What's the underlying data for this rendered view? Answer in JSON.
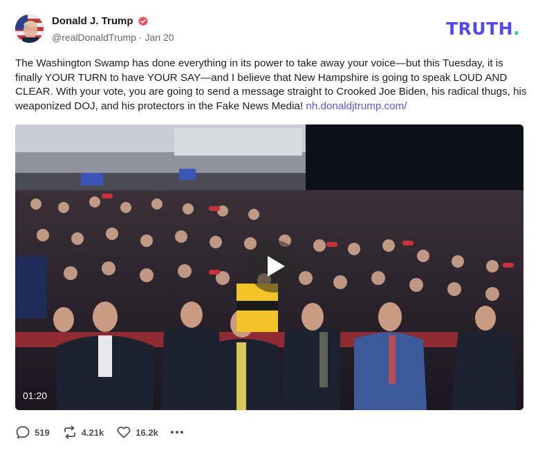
{
  "author": {
    "display_name": "Donald J. Trump",
    "handle": "@realDonaldTrump",
    "separator": "·",
    "date": "Jan 20",
    "verified": true
  },
  "brand": {
    "wordmark": "TRUTH",
    "dot": ".",
    "color": "#5448ee",
    "dot_color": "#27c5a3"
  },
  "post": {
    "text": "The Washington Swamp has done everything in its power to take away your voice—but this Tuesday, it is finally YOUR TURN to have YOUR SAY—and I believe that New Hampshire is going to speak LOUD AND CLEAR. With your vote, you are going to send a message straight to Crooked Joe Biden, his radical thugs, his weaponized DOJ, and his protectors in the Fake News Media! ",
    "link_text": "nh.donaldjtrump.com/"
  },
  "video": {
    "duration": "01:20",
    "play_icon": "play-icon"
  },
  "actions": {
    "replies": "519",
    "retruths": "4.21k",
    "likes": "16.2k",
    "icons": [
      "reply-icon",
      "retruth-icon",
      "heart-icon",
      "more-icon"
    ]
  }
}
